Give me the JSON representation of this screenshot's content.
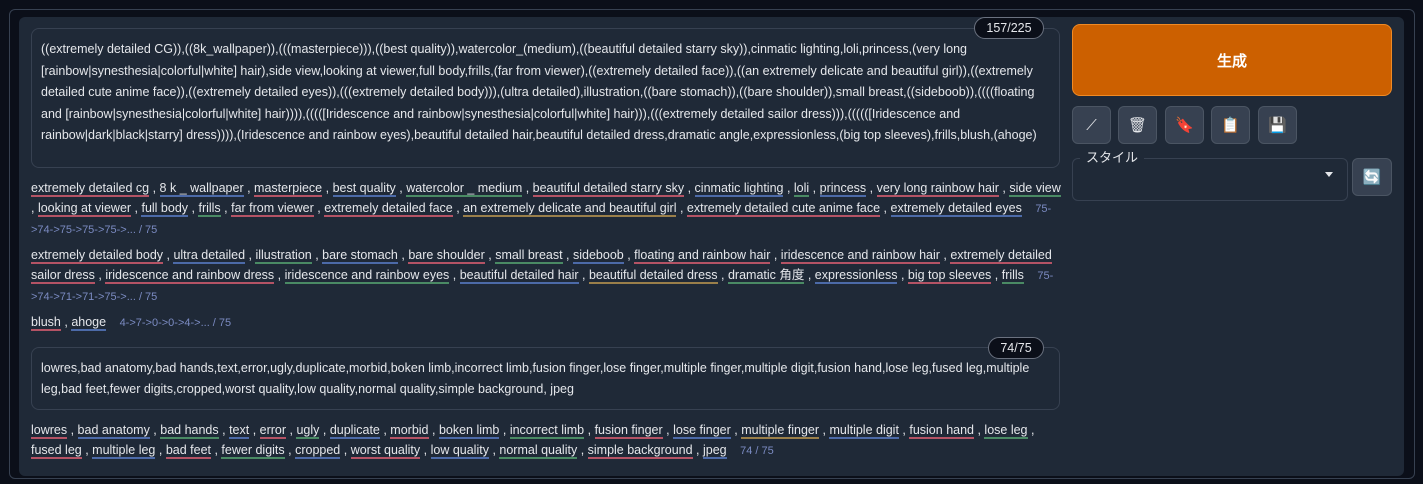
{
  "prompt": {
    "text": "((extremely detailed CG)),((8k_wallpaper)),(((masterpiece))),((best quality)),watercolor_(medium),((beautiful detailed starry sky)),cinmatic lighting,loli,princess,(very long [rainbow|synesthesia|colorful|white] hair),side view,looking at viewer,full body,frills,(far from viewer),((extremely detailed face)),((an extremely delicate and beautiful girl)),((extremely detailed cute anime face)),((extremely detailed eyes)),(((extremely detailed body))),(ultra detailed),illustration,((bare stomach)),((bare shoulder)),small breast,((sideboob)),((((floating and [rainbow|synesthesia|colorful|white] hair)))),(((([Iridescence and rainbow|synesthesia|colorful|white] hair))),(((extremely detailed sailor dress))),((((([Iridescence and rainbow|dark|black|starry] dress)))),(Iridescence and rainbow eyes),beautiful detailed hair,beautiful detailed dress,dramatic angle,expressionless,(big top sleeves),frills,blush,(ahoge)",
    "counter": "157/225"
  },
  "token_groups": [
    {
      "tokens": [
        {
          "t": "extremely detailed cg",
          "c": "c1"
        },
        {
          "t": "8 k _ wallpaper",
          "c": "c3"
        },
        {
          "t": "masterpiece",
          "c": "c1"
        },
        {
          "t": "best quality",
          "c": "c3"
        },
        {
          "t": "watercolor _ medium",
          "c": "c2"
        },
        {
          "t": "beautiful detailed starry sky",
          "c": "c1"
        },
        {
          "t": "cinmatic lighting",
          "c": "c3"
        },
        {
          "t": "loli",
          "c": "c2"
        },
        {
          "t": "princess",
          "c": "c3"
        },
        {
          "t": "very long rainbow hair",
          "c": "c1"
        },
        {
          "t": "side view",
          "c": "c2"
        },
        {
          "t": "looking at viewer",
          "c": "c1"
        },
        {
          "t": "full body",
          "c": "c3"
        },
        {
          "t": "frills",
          "c": "c2"
        },
        {
          "t": "far from viewer",
          "c": "c1"
        },
        {
          "t": "extremely detailed face",
          "c": "c1"
        },
        {
          "t": "an extremely delicate and beautiful girl",
          "c": "c4"
        },
        {
          "t": "extremely detailed cute anime face",
          "c": "c1"
        },
        {
          "t": "extremely detailed eyes",
          "c": "c3"
        }
      ],
      "count": "75->74->75->75->75->... / 75"
    },
    {
      "tokens": [
        {
          "t": "extremely detailed body",
          "c": "c1"
        },
        {
          "t": "ultra detailed",
          "c": "c3"
        },
        {
          "t": "illustration",
          "c": "c2"
        },
        {
          "t": "bare stomach",
          "c": "c3"
        },
        {
          "t": "bare shoulder",
          "c": "c1"
        },
        {
          "t": "small breast",
          "c": "c2"
        },
        {
          "t": "sideboob",
          "c": "c3"
        },
        {
          "t": "floating and rainbow hair",
          "c": "c1"
        },
        {
          "t": "iridescence and rainbow hair",
          "c": "c1"
        },
        {
          "t": "extremely detailed sailor dress",
          "c": "c1"
        },
        {
          "t": "iridescence and rainbow dress",
          "c": "c1"
        },
        {
          "t": "iridescence and rainbow eyes",
          "c": "c2"
        },
        {
          "t": "beautiful detailed hair",
          "c": "c3"
        },
        {
          "t": "beautiful detailed dress",
          "c": "c4"
        },
        {
          "t": "dramatic 角度",
          "c": "c2"
        },
        {
          "t": "expressionless",
          "c": "c3"
        },
        {
          "t": "big top sleeves",
          "c": "c1"
        },
        {
          "t": "frills",
          "c": "c2"
        }
      ],
      "count": "75->74->71->71->75->... / 75"
    },
    {
      "tokens": [
        {
          "t": "blush",
          "c": "c1"
        },
        {
          "t": "ahoge",
          "c": "c3"
        }
      ],
      "count": "4->7->0->0->4->... / 75"
    }
  ],
  "negative": {
    "text": "lowres,bad anatomy,bad hands,text,error,ugly,duplicate,morbid,boken limb,incorrect limb,fusion finger,lose finger,multiple finger,multiple digit,fusion hand,lose leg,fused leg,multiple leg,bad feet,fewer digits,cropped,worst quality,low quality,normal quality,simple background, jpeg",
    "counter": "74/75"
  },
  "negative_tokens": {
    "tokens": [
      {
        "t": "lowres",
        "c": "c1"
      },
      {
        "t": "bad anatomy",
        "c": "c3"
      },
      {
        "t": "bad hands",
        "c": "c2"
      },
      {
        "t": "text",
        "c": "c3"
      },
      {
        "t": "error",
        "c": "c1"
      },
      {
        "t": "ugly",
        "c": "c2"
      },
      {
        "t": "duplicate",
        "c": "c3"
      },
      {
        "t": "morbid",
        "c": "c1"
      },
      {
        "t": "boken limb",
        "c": "c3"
      },
      {
        "t": "incorrect limb",
        "c": "c2"
      },
      {
        "t": "fusion finger",
        "c": "c1"
      },
      {
        "t": "lose finger",
        "c": "c3"
      },
      {
        "t": "multiple finger",
        "c": "c4"
      },
      {
        "t": "multiple digit",
        "c": "c3"
      },
      {
        "t": "fusion hand",
        "c": "c1"
      },
      {
        "t": "lose leg",
        "c": "c2"
      },
      {
        "t": "fused leg",
        "c": "c1"
      },
      {
        "t": "multiple leg",
        "c": "c3"
      },
      {
        "t": "bad feet",
        "c": "c1"
      },
      {
        "t": "fewer digits",
        "c": "c2"
      },
      {
        "t": "cropped",
        "c": "c3"
      },
      {
        "t": "worst quality",
        "c": "c1"
      },
      {
        "t": "low quality",
        "c": "c3"
      },
      {
        "t": "normal quality",
        "c": "c2"
      },
      {
        "t": "simple background",
        "c": "c1"
      },
      {
        "t": "jpeg",
        "c": "c3"
      }
    ],
    "count": "74 / 75"
  },
  "generate_label": "生成",
  "tools": [
    {
      "icon": "pencil-icon",
      "glyph": "⟋"
    },
    {
      "icon": "trash-icon",
      "glyph": "🗑"
    },
    {
      "icon": "bookmark-icon",
      "glyph": "🔖"
    },
    {
      "icon": "clipboard-icon",
      "glyph": "📋"
    },
    {
      "icon": "save-icon",
      "glyph": "💾"
    }
  ],
  "style": {
    "label": "スタイル",
    "value": ""
  },
  "refresh_glyph": "🔄",
  "colors": {
    "accent": "#cc6000",
    "panel": "#1f2937",
    "background": "#0b0f19"
  }
}
